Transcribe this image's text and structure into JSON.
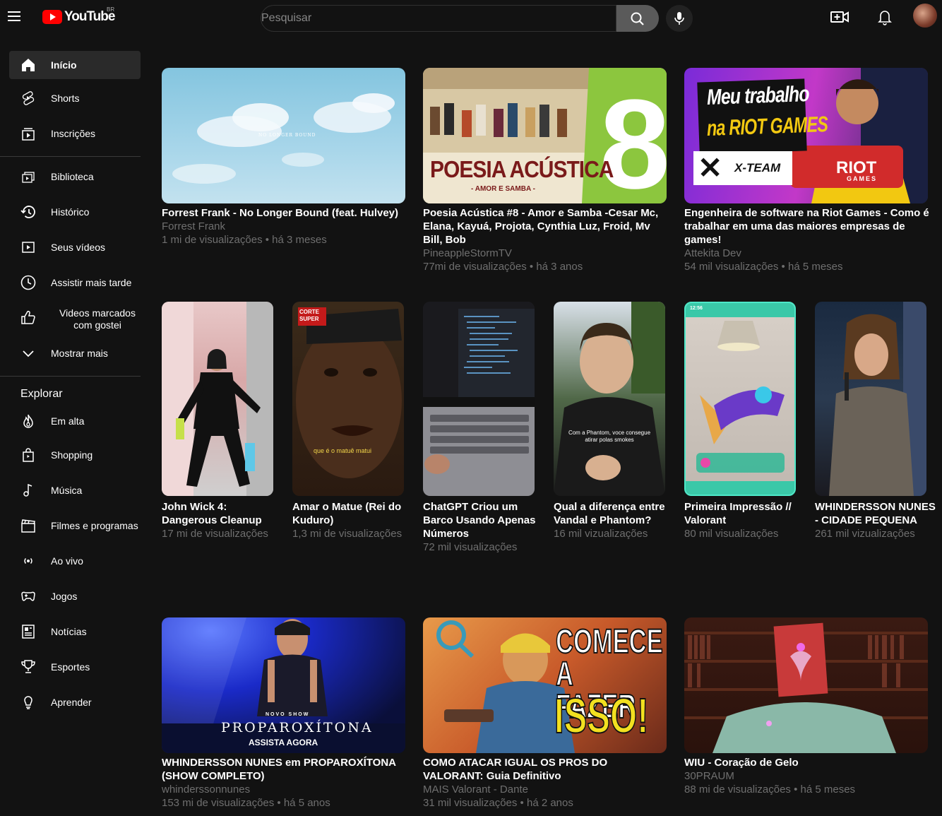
{
  "header": {
    "logo_text": "YouTube",
    "country_code": "BR",
    "search_placeholder": "Pesquisar"
  },
  "sidebar": {
    "main": [
      "Início",
      "Shorts",
      "Inscrições"
    ],
    "library": [
      "Biblioteca",
      "Histórico",
      "Seus vídeos",
      "Assistir mais tarde",
      "Videos marcados com gostei",
      "Mostrar mais"
    ],
    "explore_title": "Explorar",
    "explore": [
      "Em alta",
      "Shopping",
      "Música",
      "Filmes e programas",
      "Ao vivo",
      "Jogos",
      "Notícias",
      "Esportes",
      "Aprender"
    ]
  },
  "row1": [
    {
      "title": "Forrest Frank - No Longer Bound (feat. Hulvey)",
      "channel": "Forrest Frank",
      "stats": "1 mi de visualizações • há 3 meses",
      "thumb_text": "NO LONGER BOUND"
    },
    {
      "title": "Poesia Acústica #8 - Amor e Samba -Cesar Mc, Elana, Kayuá, Projota, Cynthia Luz, Froid, Mv Bill, Bob",
      "channel": "PineappleStormTV",
      "stats": "77mi de visualizações • há 3 anos",
      "thumb_text": "POESIA ACÚSTICA",
      "thumb_sub": "- AMOR E SAMBA -",
      "thumb_num": "8"
    },
    {
      "title": "Engenheira de software na Riot Games - Como é trabalhar em uma das maiores empresas de games!",
      "channel": "Attekita Dev",
      "stats": "54 mil visualizações • há 5 meses",
      "thumb_text1": "Meu trabalho",
      "thumb_text2": "na RIOT GAMES",
      "thumb_xteam": "X-TEAM",
      "thumb_riot": "RIOT",
      "thumb_games": "GAMES"
    }
  ],
  "shorts": [
    {
      "title": "John Wick 4: Dangerous Cleanup",
      "stats": "17 mi de visualizações"
    },
    {
      "title": "Amar o Matue (Rei do Kuduro)",
      "stats": "1,3 mi de visualizações",
      "overlay": "que é o matuê matui",
      "badge": "CORTE SUPER"
    },
    {
      "title": "ChatGPT Criou um Barco Usando Apenas Números",
      "stats": "72 mil visualizações"
    },
    {
      "title": "Qual a diferença entre Vandal e Phantom?",
      "stats": "16 mil vizualizações",
      "overlay": "Com a Phantom, voce consegue atirar polas smokes"
    },
    {
      "title": "Primeira Impressão // Valorant",
      "stats": "80 mil visualizações",
      "overlay": "12:56"
    },
    {
      "title": "WHINDERSSON NUNES - CIDADE PEQUENA",
      "stats": "261 mil vizualizações"
    }
  ],
  "row3": [
    {
      "title": "WHINDERSSON NUNES em PROPAROXÍTONA (SHOW COMPLETO)",
      "channel": "whinderssonnunes",
      "stats": "153 mi de visualizações • há 5 anos",
      "thumb_small": "NOVO SHOW",
      "thumb_text": "PROPAROXÍTONA",
      "thumb_sub": "ASSISTA AGORA"
    },
    {
      "title": "COMO ATACAR IGUAL OS PROS DO VALORANT: Guia Definitivo",
      "channel": "MAIS Valorant - Dante",
      "stats": "31 mil visualizações • há 2 anos",
      "thumb_text1": "COMECE",
      "thumb_text2": "A FAZER",
      "thumb_text3": "ISSO!"
    },
    {
      "title": "WIU - Coração de Gelo",
      "channel": "30PRAUM",
      "stats": "88 mi de visualizações • há 5 meses"
    }
  ]
}
